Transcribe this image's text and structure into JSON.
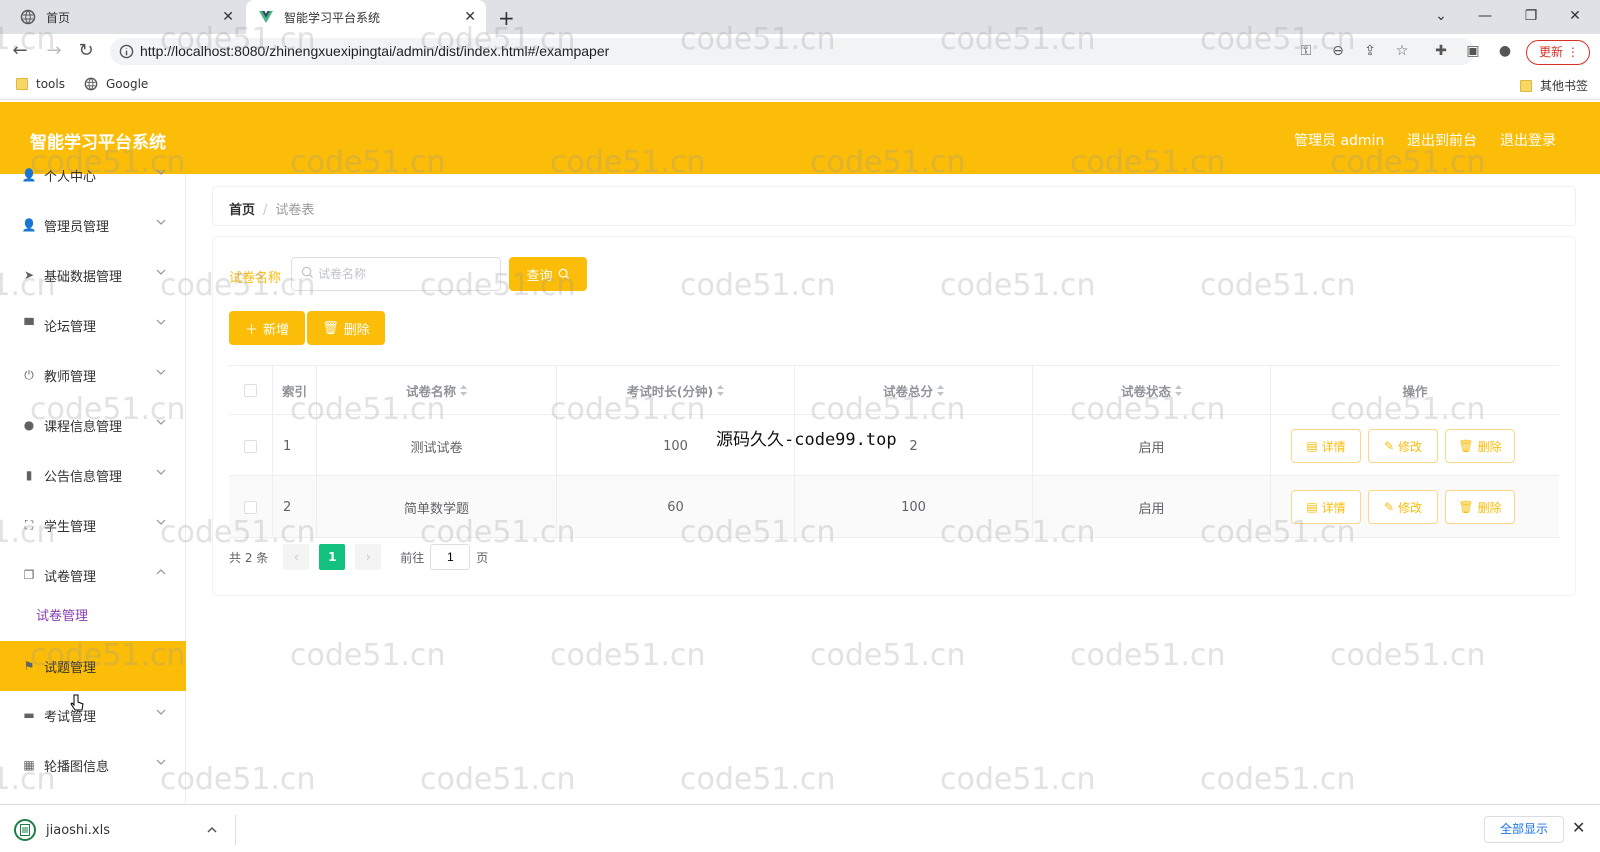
{
  "browser": {
    "tabs": [
      {
        "title": "首页"
      },
      {
        "title": "智能学习平台系统"
      }
    ],
    "url": "http://localhost:8080/zhinengxuexipingtai/admin/dist/index.html#/exampaper",
    "update_label": "更新",
    "bookmarks": [
      {
        "label": "tools"
      },
      {
        "label": "Google"
      }
    ],
    "other_bookmarks": "其他书签"
  },
  "header": {
    "title": "智能学习平台系统",
    "user": "管理员 admin",
    "back_to_front": "退出到前台",
    "logout": "退出登录"
  },
  "sidebar": {
    "items": [
      {
        "label": "个人中心",
        "icon": "user-icon"
      },
      {
        "label": "管理员管理",
        "icon": "user-icon"
      },
      {
        "label": "基础数据管理",
        "icon": "send-icon"
      },
      {
        "label": "论坛管理",
        "icon": "monitor-icon"
      },
      {
        "label": "教师管理",
        "icon": "power-icon"
      },
      {
        "label": "课程信息管理",
        "icon": "pin-icon"
      },
      {
        "label": "公告信息管理",
        "icon": "bar-chart-icon"
      },
      {
        "label": "学生管理",
        "icon": "expand-icon"
      },
      {
        "label": "试卷管理",
        "icon": "copy-icon"
      },
      {
        "label": "试题管理",
        "icon": "flag-icon"
      },
      {
        "label": "考试管理",
        "icon": "podium-icon"
      },
      {
        "label": "轮播图信息",
        "icon": "grid-icon"
      }
    ],
    "sub_item": "试卷管理"
  },
  "breadcrumb": {
    "home": "首页",
    "current": "试卷表"
  },
  "search": {
    "label": "试卷名称",
    "placeholder": "试卷名称",
    "button": "查询"
  },
  "actions": {
    "add": "新增",
    "delete": "删除"
  },
  "table": {
    "headers": [
      "索引",
      "试卷名称",
      "考试时长(分钟)",
      "试卷总分",
      "试卷状态",
      "操作"
    ],
    "rows": [
      {
        "index": "1",
        "name": "测试试卷",
        "duration": "100",
        "score": "2",
        "status": "启用"
      },
      {
        "index": "2",
        "name": "简单数学题",
        "duration": "60",
        "score": "100",
        "status": "启用"
      }
    ],
    "row_actions": {
      "detail": "详情",
      "edit": "修改",
      "delete": "删除"
    }
  },
  "pagination": {
    "total": "共 2 条",
    "current_page": "1",
    "goto_prefix": "前往",
    "goto_value": "1",
    "goto_suffix": "页"
  },
  "downloads": {
    "file": "jiaoshi.xls",
    "show_all": "全部显示"
  },
  "watermark": {
    "text": "code51.cn",
    "center": "源码久久-code99.top"
  },
  "colors": {
    "accent": "#fbbd08",
    "pager_active": "#13c17f",
    "submenu_text": "#8b3fb0"
  }
}
